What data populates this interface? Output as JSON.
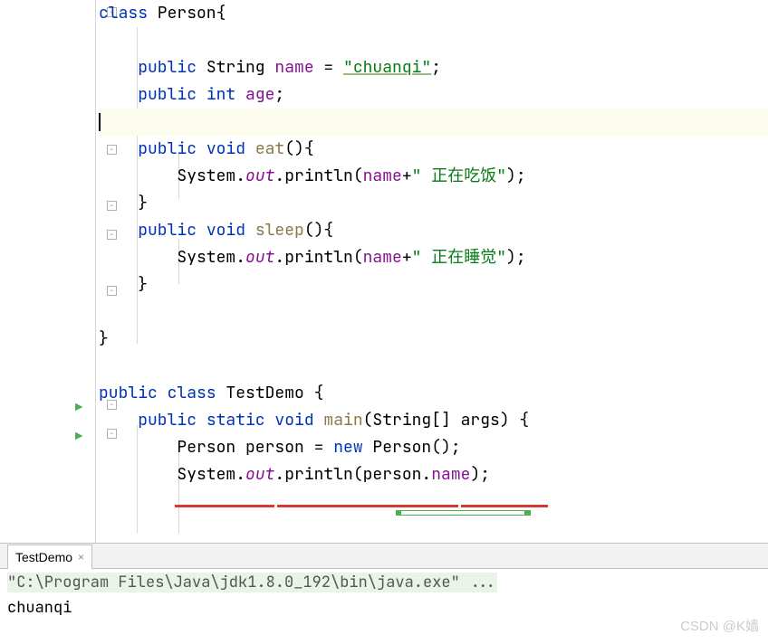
{
  "code": {
    "l1": {
      "kw1": "class",
      "type": " Person{"
    },
    "l3": {
      "kw": "public ",
      "type": "String ",
      "field": "name",
      "eq": " = ",
      "str": "\"chuanqi\"",
      "semi": ";"
    },
    "l4": {
      "kw": "public ",
      "type2": "int ",
      "field": "age",
      "semi": ";"
    },
    "l6": {
      "kw": "public ",
      "kw2": "void ",
      "method": "eat",
      "paren": "(){"
    },
    "l7": {
      "sys": "System.",
      "out": "out",
      "dot": ".println(",
      "field": "name",
      "plus": "+",
      "str": "\" 正在吃饭\"",
      "close": ");"
    },
    "l8": {
      "brace": "}"
    },
    "l9": {
      "kw": "public ",
      "kw2": "void ",
      "method": "sleep",
      "paren": "(){"
    },
    "l10": {
      "sys": "System.",
      "out": "out",
      "dot": ".println(",
      "field": "name",
      "plus": "+",
      "str": "\" 正在睡觉\"",
      "close": ");"
    },
    "l11": {
      "brace": "}"
    },
    "l13": {
      "brace": "}"
    },
    "l15": {
      "kw": "public ",
      "kw2": "class ",
      "type": "TestDemo {"
    },
    "l16": {
      "kw": "public ",
      "kw2": "static ",
      "kw3": "void ",
      "method": "main",
      "paren": "(String[] args) {"
    },
    "l17": {
      "type": "Person person = ",
      "kw": "new ",
      "ctor": "Person();"
    },
    "l18": {
      "sys": "System.",
      "out": "out",
      "dot": ".println(person.",
      "field": "name",
      "close": ");"
    }
  },
  "tab": {
    "label": "TestDemo",
    "close": "×"
  },
  "console": {
    "cmd": "\"C:\\Program Files\\Java\\jdk1.8.0_192\\bin\\java.exe\" ...",
    "out": "chuanqi"
  },
  "watermark": "CSDN @K嫱"
}
